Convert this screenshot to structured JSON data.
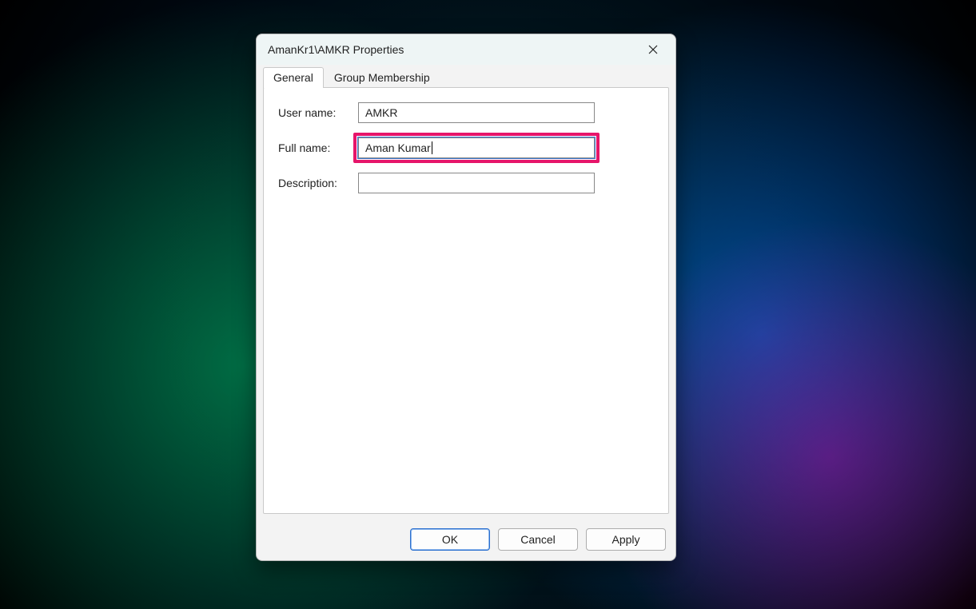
{
  "dialog": {
    "title": "AmanKr1\\AMKR Properties",
    "tabs": {
      "general": "General",
      "group_membership": "Group Membership"
    },
    "fields": {
      "username_label": "User name:",
      "username_value": "AMKR",
      "fullname_label": "Full name:",
      "fullname_value": "Aman Kumar",
      "description_label": "Description:",
      "description_value": ""
    },
    "buttons": {
      "ok": "OK",
      "cancel": "Cancel",
      "apply": "Apply"
    }
  }
}
